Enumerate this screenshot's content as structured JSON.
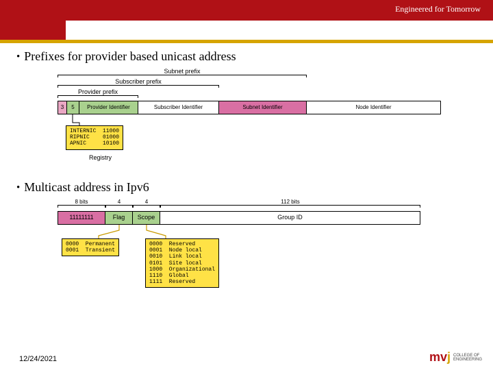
{
  "header": {
    "tagline": "Engineered for Tomorrow"
  },
  "bullets": {
    "prefixes": "Prefixes for provider based unicast address",
    "multicast": "Multicast address in Ipv6"
  },
  "unicast": {
    "brackets": {
      "subnet": "Subnet prefix",
      "subscriber": "Subscriber prefix",
      "provider": "Provider prefix"
    },
    "fields": {
      "three": "3",
      "five": "5",
      "provider_id": "Provider Identifier",
      "subscriber_id": "Subscriber Identifier",
      "subnet_id": "Subnet Identifier",
      "node_id": "Node Identifier"
    },
    "registry_label": "Registry",
    "registry_box": "INTERNIC  11000\nRIPNIC    01000\nAPNIC     10100"
  },
  "multicast2": {
    "widths": {
      "bits8": "8 bits",
      "four_a": "4",
      "four_b": "4",
      "bits112": "112 bits"
    },
    "fields": {
      "ones": "11111111",
      "flag": "Flag",
      "scope": "Scope",
      "group": "Group ID"
    },
    "flag_box": "0000  Permanent\n0001  Transient",
    "scope_box": "0000  Reserved\n0001  Node local\n0010  Link local\n0101  Site local\n1000  Organizational\n1110  Global\n1111  Reserved"
  },
  "footer": {
    "date": "12/24/2021"
  },
  "logo": {
    "brand": "mvj",
    "line1": "COLLEGE OF",
    "line2": "ENGINEERING"
  }
}
